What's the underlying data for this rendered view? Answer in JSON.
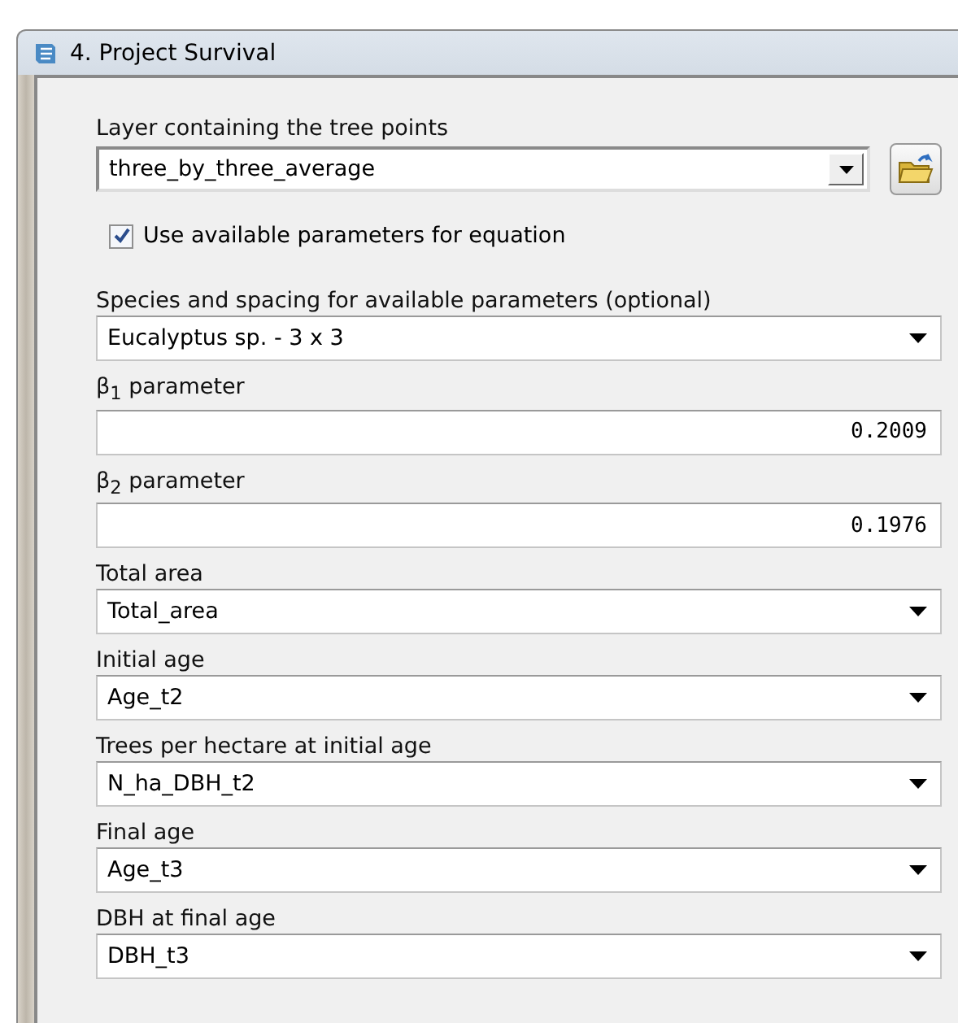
{
  "window": {
    "title": "4. Project Survival"
  },
  "fields": [
    {
      "kind": "combo",
      "label": "Layer containing the tree points",
      "value": "three_by_three_average"
    },
    {
      "kind": "checkbox",
      "label": "Use available parameters for equation",
      "checked": true
    },
    {
      "kind": "dropdown",
      "label": "Species and spacing for available parameters (optional)",
      "value": "Eucalyptus sp. - 3 x 3"
    },
    {
      "kind": "number",
      "label": "β$_{1}$ parameter",
      "value": "0.2009"
    },
    {
      "kind": "number",
      "label": "β$_{2}$ parameter",
      "value": "0.1976"
    },
    {
      "kind": "dropdown",
      "label": "Total area",
      "value": "Total_area"
    },
    {
      "kind": "dropdown",
      "label": "Initial age",
      "value": "Age_t2"
    },
    {
      "kind": "dropdown",
      "label": "Trees per hectare at initial age",
      "value": "N_ha_DBH_t2"
    },
    {
      "kind": "dropdown",
      "label": "Final age",
      "value": "Age_t3"
    },
    {
      "kind": "dropdown",
      "label": "DBH at final age",
      "value": "DBH_t3"
    }
  ]
}
